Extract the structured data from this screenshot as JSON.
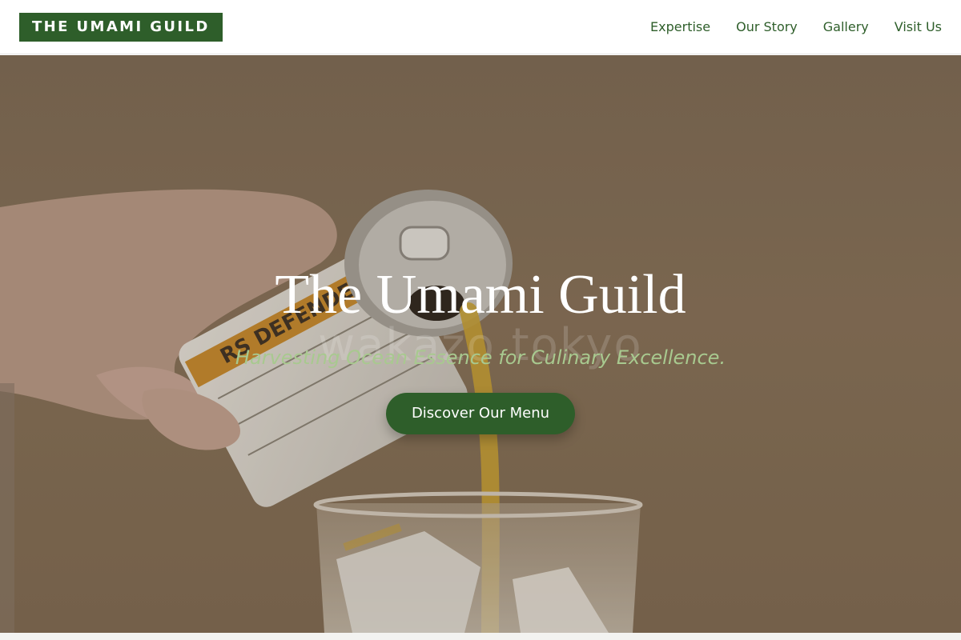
{
  "header": {
    "logo": "THE UMAMI GUILD",
    "nav": [
      "Expertise",
      "Our Story",
      "Gallery",
      "Visit Us"
    ]
  },
  "hero": {
    "title": "The Umami Guild",
    "tagline": "Harvesting Ocean Essence for Culinary Excellence.",
    "cta_label": "Discover Our Menu",
    "watermark": "wakazo tokyo",
    "can_label": "RS DEFENDER"
  },
  "colors": {
    "brand_green": "#2e5e2a",
    "tagline_green": "#a8c98f",
    "hero_tan": "#857058"
  }
}
